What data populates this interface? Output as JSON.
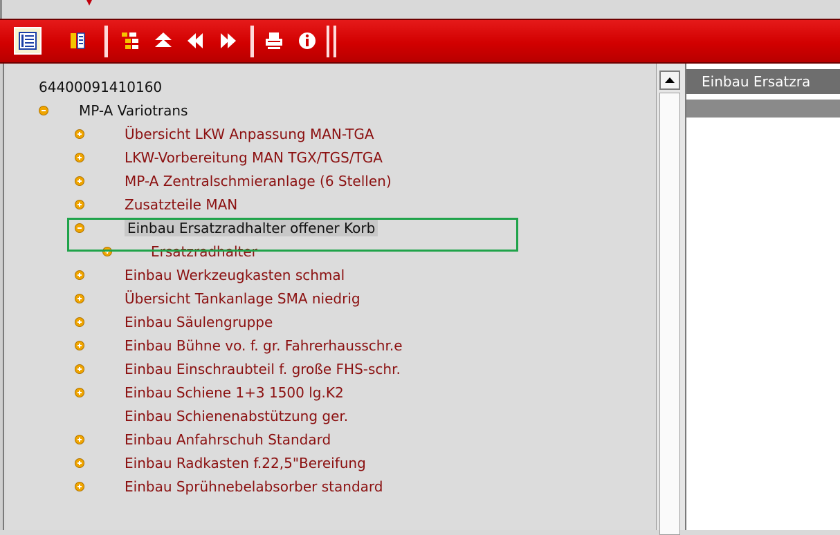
{
  "toolbar": {
    "buttons": [
      {
        "name": "tree-view-icon",
        "active": true
      },
      {
        "name": "list-view-icon",
        "active": false
      },
      {
        "name": "structure-icon",
        "active": false
      },
      {
        "name": "collapse-up-icon",
        "active": false
      },
      {
        "name": "previous-icon",
        "active": false
      },
      {
        "name": "next-icon",
        "active": false
      },
      {
        "name": "print-icon",
        "active": false
      },
      {
        "name": "info-icon",
        "active": false
      }
    ],
    "colors": {
      "bar": "#d20000",
      "icon_yellow": "#f5c400",
      "icon_blue": "#1a3fa6"
    }
  },
  "tree": {
    "root_label": "64400091410160",
    "items": [
      {
        "label": "MP-A  Variotrans",
        "toggle": "minus",
        "level": 1
      },
      {
        "label": "Übersicht LKW Anpassung MAN-TGA",
        "toggle": "plus",
        "level": 2
      },
      {
        "label": "LKW-Vorbereitung MAN TGX/TGS/TGA",
        "toggle": "plus",
        "level": 2
      },
      {
        "label": "MP-A Zentralschmieranlage (6 Stellen)",
        "toggle": "plus",
        "level": 2
      },
      {
        "label": "Zusatzteile MAN",
        "toggle": "plus",
        "level": 2
      },
      {
        "label": "Einbau Ersatzradhalter offener Korb",
        "toggle": "minus",
        "level": 2,
        "selected": true
      },
      {
        "label": "Ersatzradhalter",
        "toggle": "plus",
        "level": 3
      },
      {
        "label": "Einbau Werkzeugkasten schmal",
        "toggle": "plus",
        "level": 2
      },
      {
        "label": "Übersicht Tankanlage SMA niedrig",
        "toggle": "plus",
        "level": 2
      },
      {
        "label": "Einbau Säulengruppe",
        "toggle": "plus",
        "level": 2
      },
      {
        "label": "Einbau Bühne vo. f. gr. Fahrerhausschr.e",
        "toggle": "plus",
        "level": 2
      },
      {
        "label": "Einbau Einschraubteil f. große FHS-schr.",
        "toggle": "plus",
        "level": 2
      },
      {
        "label": "Einbau Schiene 1+3 1500 lg.K2",
        "toggle": "plus",
        "level": 2
      },
      {
        "label": "Einbau Schienenabstützung ger.",
        "toggle": "none",
        "level": 2
      },
      {
        "label": "Einbau Anfahrschuh Standard",
        "toggle": "plus",
        "level": 2
      },
      {
        "label": "Einbau Radkasten f.22,5\"Bereifung",
        "toggle": "plus",
        "level": 2
      },
      {
        "label": "Einbau Sprühnebelabsorber standard",
        "toggle": "plus",
        "level": 2
      }
    ]
  },
  "right_pane": {
    "header": "Einbau Ersatzra"
  },
  "colors": {
    "tree_text": "#8b1010",
    "highlight": "#1fa34a",
    "toggle": "#f0a500"
  }
}
